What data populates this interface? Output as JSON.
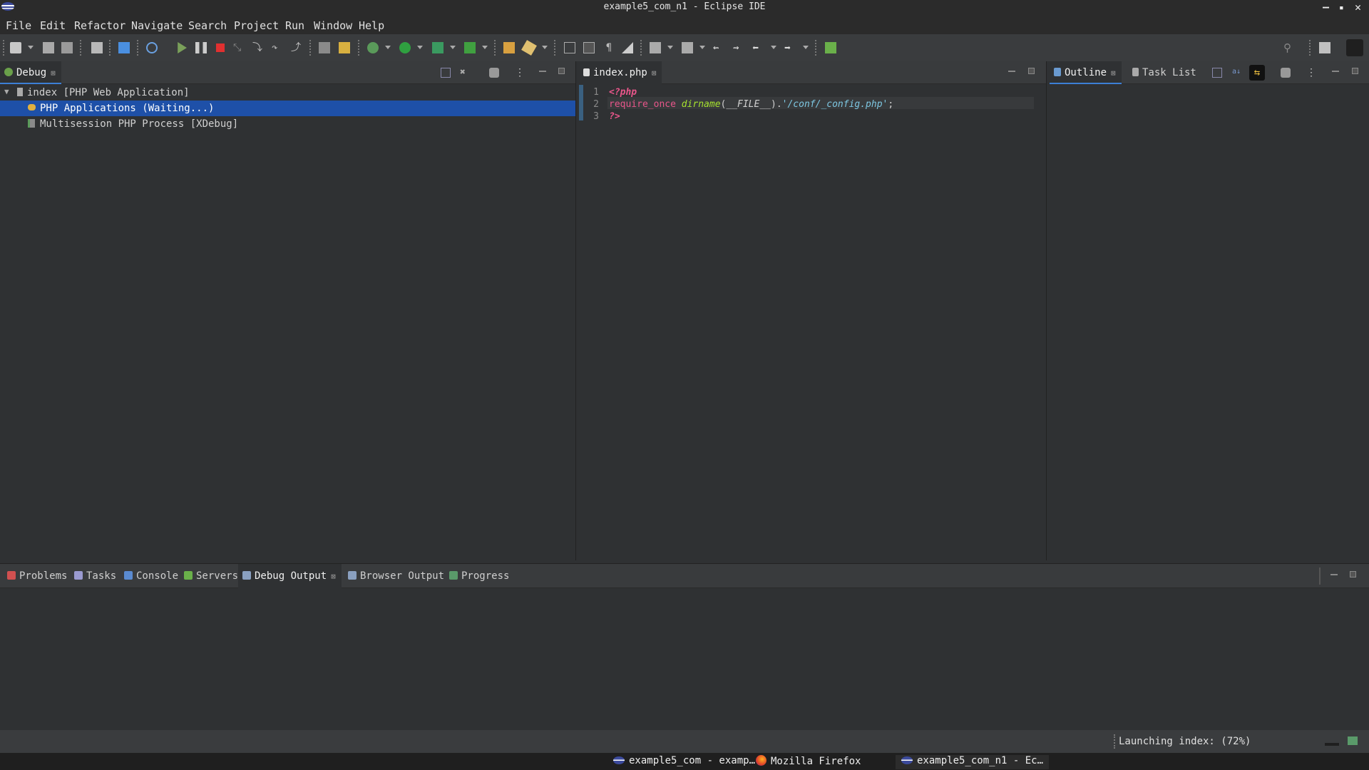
{
  "window": {
    "title": "example5_com_n1 - Eclipse IDE",
    "minimize": "‒",
    "restore": "▪",
    "close": "✕"
  },
  "menu": [
    "File",
    "Edit",
    "Refactor",
    "Navigate",
    "Search",
    "Project",
    "Run",
    "Window",
    "Help"
  ],
  "debug_panel": {
    "tab_label": "Debug",
    "tree": [
      {
        "label": "index [PHP Web Application]",
        "level": 0,
        "expanded": true,
        "selected": false,
        "icon": "launch-config-icon"
      },
      {
        "label": "PHP Applications (Waiting...)",
        "level": 1,
        "selected": true,
        "icon": "debug-target-icon"
      },
      {
        "label": "Multisession PHP Process [XDebug]",
        "level": 1,
        "selected": false,
        "icon": "process-icon"
      }
    ]
  },
  "editor": {
    "tab_label": "index.php",
    "lines": [
      {
        "num": "1",
        "tokens": [
          {
            "text": "<?php",
            "cls": "kw-italic"
          }
        ]
      },
      {
        "num": "2",
        "tokens": [
          {
            "text": "require_once",
            "cls": "kw"
          },
          {
            "text": " ",
            "cls": "plain"
          },
          {
            "text": "dirname",
            "cls": "fn"
          },
          {
            "text": "(",
            "cls": "plain"
          },
          {
            "text": "__FILE__",
            "cls": "const"
          },
          {
            "text": ").",
            "cls": "plain"
          },
          {
            "text": "'/conf/_config.php'",
            "cls": "str"
          },
          {
            "text": ";",
            "cls": "plain"
          }
        ]
      },
      {
        "num": "3",
        "tokens": [
          {
            "text": "?>",
            "cls": "kw-italic"
          }
        ]
      }
    ]
  },
  "outline_panel": {
    "tabs": [
      "Outline",
      "Task List"
    ]
  },
  "bottom_panel": {
    "tabs": [
      {
        "label": "Problems",
        "icon": "problems-icon",
        "active": false
      },
      {
        "label": "Tasks",
        "icon": "tasks-icon",
        "active": false
      },
      {
        "label": "Console",
        "icon": "console-icon",
        "active": false
      },
      {
        "label": "Servers",
        "icon": "servers-icon",
        "active": false
      },
      {
        "label": "Debug Output",
        "icon": "debug-output-icon",
        "active": true
      },
      {
        "label": "Browser Output",
        "icon": "browser-output-icon",
        "active": false
      },
      {
        "label": "Progress",
        "icon": "progress-icon",
        "active": false
      }
    ]
  },
  "status": {
    "progress_text": "Launching index: (72%)",
    "progress_value": 72
  },
  "taskbar": [
    {
      "label": "example5_com - examp…",
      "icon": "eclipse-icon"
    },
    {
      "label": "Mozilla Firefox",
      "icon": "firefox-icon"
    },
    {
      "label": "example5_com_n1 - Ec…",
      "icon": "eclipse-icon"
    }
  ],
  "colors": {
    "accent": "#1e50a8",
    "keyword": "#e8568a",
    "function": "#a6e22e",
    "string": "#7ec8e3",
    "background": "#2f3133"
  }
}
